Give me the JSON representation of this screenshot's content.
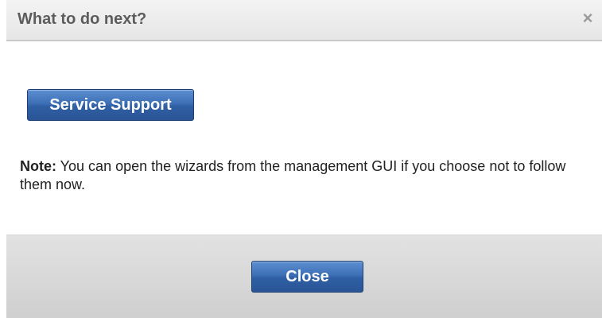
{
  "dialog": {
    "title": "What to do next?",
    "close_icon": "×"
  },
  "body": {
    "service_button_label": "Service Support",
    "note_label": "Note:",
    "note_text": " You can open the wizards from the management GUI if you choose not to follow them now."
  },
  "footer": {
    "close_button_label": "Close"
  },
  "colors": {
    "button_blue": "#3d6fb5",
    "title_text": "#5c5c5c",
    "footer_gray": "#d6d6d6"
  }
}
